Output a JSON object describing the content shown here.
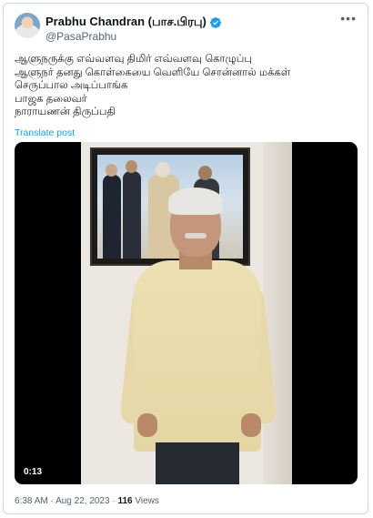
{
  "tweet": {
    "author": {
      "display_name": "Prabhu Chandran (பாச.பிரபு)",
      "handle": "@PasaPrabhu",
      "verified": true
    },
    "body_lines": [
      "ஆளுநருக்கு எவ்வளவு திமிர் எவ்வளவு கொழுப்பு",
      "ஆளுநர் தனது கொள்கையை வெளியே சொன்னால் மக்கள்",
      "செருப்பால அடிப்பாங்க",
      "பாஜக தலைவர்",
      "நாராயணன் திருப்பதி"
    ],
    "translate_label": "Translate post",
    "video": {
      "timestamp": "0:13"
    },
    "posted_time": "6:38 AM",
    "posted_date": "Aug 22, 2023",
    "views_count": "116",
    "views_label": "Views",
    "separator": "·",
    "more_icon": "more-horizontal-icon"
  },
  "colors": {
    "accent": "#1d9bf0",
    "text": "#0f1419",
    "muted": "#536471"
  }
}
